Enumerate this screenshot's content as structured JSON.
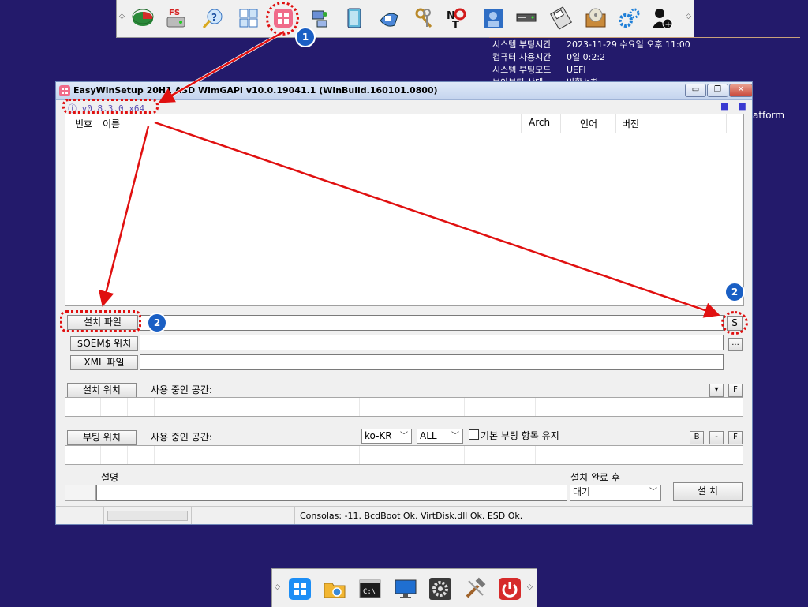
{
  "top_taskbar": {
    "icons": [
      "partition-icon",
      "fs-drive-icon",
      "wizard-icon",
      "grid-app-icon",
      "easywinsetup-icon",
      "network-icon",
      "notebook-icon",
      "hardware-icon",
      "keys-icon",
      "no-tool-icon",
      "users-icon",
      "drive-bay-icon",
      "floppy-icon",
      "cd-box-icon",
      "gears-icon",
      "add-user-icon"
    ]
  },
  "sysinfo": {
    "rows": [
      {
        "k": "시스템 부팅시간",
        "v": "2023-11-29 수요일 오후 11:00"
      },
      {
        "k": "컴퓨터 사용시간",
        "v": "0일 0:2:2"
      },
      {
        "k": "시스템 부팅모드",
        "v": "UEFI"
      },
      {
        "k": "보안부팅 상태",
        "v": "비활성화"
      }
    ],
    "platform_text": "atform"
  },
  "window": {
    "title": "EasyWinSetup  20H1 ASD  WimGAPI v10.0.19041.1 (WinBuild.160101.0800)",
    "version": "ⓘ v0.8.3.0 x64",
    "dots": "■■",
    "controls": {
      "minimize": "▭",
      "maximize": "❐",
      "close": "✕"
    },
    "list_headers": {
      "num": "번호",
      "name": "이름",
      "arch": "Arch",
      "lang": "언어",
      "ver": "버전"
    },
    "install_file_btn": "설치 파일",
    "oem_btn": "$OEM$ 위치",
    "xml_btn": "XML 파일",
    "s_btn": "S",
    "more_btn": "...",
    "install_loc_btn": "설치 위치",
    "used_space_label": "사용 중인 공간:",
    "dropdown_btn": "▾",
    "f_btn": "F",
    "boot_loc_btn": "부팅 위치",
    "boot_used_space_label": "사용 중인 공간:",
    "lang_select": "ko-KR",
    "all_select": "ALL",
    "keep_boot_label": "기본 부팅 항목 유지",
    "b_btn": "B",
    "minus_btn": "-",
    "f2_btn": "F",
    "desc_label": "설명",
    "after_install_label": "설치 완료 후",
    "after_install_select": "대기",
    "install_btn": "설 치",
    "status_text": "Consolas: -11. BcdBoot Ok. VirtDisk.dll Ok. ESD Ok."
  },
  "annotations": {
    "badge1": "1",
    "badge2a": "2",
    "badge2b": "2",
    "ring_color": "#e01010",
    "badge_color": "#1a5fc4"
  },
  "bottom_taskbar": {
    "icons": [
      "windows-icon",
      "explorer-icon",
      "cmd-icon",
      "monitor-icon",
      "settings-icon",
      "tools-icon",
      "power-icon"
    ]
  }
}
